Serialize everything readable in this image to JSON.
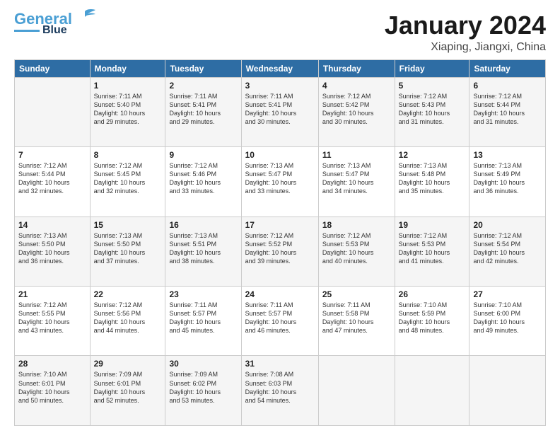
{
  "header": {
    "logo_line1": "General",
    "logo_line2": "Blue",
    "month": "January 2024",
    "location": "Xiaping, Jiangxi, China"
  },
  "weekdays": [
    "Sunday",
    "Monday",
    "Tuesday",
    "Wednesday",
    "Thursday",
    "Friday",
    "Saturday"
  ],
  "weeks": [
    [
      {
        "day": "",
        "content": ""
      },
      {
        "day": "1",
        "content": "Sunrise: 7:11 AM\nSunset: 5:40 PM\nDaylight: 10 hours\nand 29 minutes."
      },
      {
        "day": "2",
        "content": "Sunrise: 7:11 AM\nSunset: 5:41 PM\nDaylight: 10 hours\nand 29 minutes."
      },
      {
        "day": "3",
        "content": "Sunrise: 7:11 AM\nSunset: 5:41 PM\nDaylight: 10 hours\nand 30 minutes."
      },
      {
        "day": "4",
        "content": "Sunrise: 7:12 AM\nSunset: 5:42 PM\nDaylight: 10 hours\nand 30 minutes."
      },
      {
        "day": "5",
        "content": "Sunrise: 7:12 AM\nSunset: 5:43 PM\nDaylight: 10 hours\nand 31 minutes."
      },
      {
        "day": "6",
        "content": "Sunrise: 7:12 AM\nSunset: 5:44 PM\nDaylight: 10 hours\nand 31 minutes."
      }
    ],
    [
      {
        "day": "7",
        "content": "Sunrise: 7:12 AM\nSunset: 5:44 PM\nDaylight: 10 hours\nand 32 minutes."
      },
      {
        "day": "8",
        "content": "Sunrise: 7:12 AM\nSunset: 5:45 PM\nDaylight: 10 hours\nand 32 minutes."
      },
      {
        "day": "9",
        "content": "Sunrise: 7:12 AM\nSunset: 5:46 PM\nDaylight: 10 hours\nand 33 minutes."
      },
      {
        "day": "10",
        "content": "Sunrise: 7:13 AM\nSunset: 5:47 PM\nDaylight: 10 hours\nand 33 minutes."
      },
      {
        "day": "11",
        "content": "Sunrise: 7:13 AM\nSunset: 5:47 PM\nDaylight: 10 hours\nand 34 minutes."
      },
      {
        "day": "12",
        "content": "Sunrise: 7:13 AM\nSunset: 5:48 PM\nDaylight: 10 hours\nand 35 minutes."
      },
      {
        "day": "13",
        "content": "Sunrise: 7:13 AM\nSunset: 5:49 PM\nDaylight: 10 hours\nand 36 minutes."
      }
    ],
    [
      {
        "day": "14",
        "content": "Sunrise: 7:13 AM\nSunset: 5:50 PM\nDaylight: 10 hours\nand 36 minutes."
      },
      {
        "day": "15",
        "content": "Sunrise: 7:13 AM\nSunset: 5:50 PM\nDaylight: 10 hours\nand 37 minutes."
      },
      {
        "day": "16",
        "content": "Sunrise: 7:13 AM\nSunset: 5:51 PM\nDaylight: 10 hours\nand 38 minutes."
      },
      {
        "day": "17",
        "content": "Sunrise: 7:12 AM\nSunset: 5:52 PM\nDaylight: 10 hours\nand 39 minutes."
      },
      {
        "day": "18",
        "content": "Sunrise: 7:12 AM\nSunset: 5:53 PM\nDaylight: 10 hours\nand 40 minutes."
      },
      {
        "day": "19",
        "content": "Sunrise: 7:12 AM\nSunset: 5:53 PM\nDaylight: 10 hours\nand 41 minutes."
      },
      {
        "day": "20",
        "content": "Sunrise: 7:12 AM\nSunset: 5:54 PM\nDaylight: 10 hours\nand 42 minutes."
      }
    ],
    [
      {
        "day": "21",
        "content": "Sunrise: 7:12 AM\nSunset: 5:55 PM\nDaylight: 10 hours\nand 43 minutes."
      },
      {
        "day": "22",
        "content": "Sunrise: 7:12 AM\nSunset: 5:56 PM\nDaylight: 10 hours\nand 44 minutes."
      },
      {
        "day": "23",
        "content": "Sunrise: 7:11 AM\nSunset: 5:57 PM\nDaylight: 10 hours\nand 45 minutes."
      },
      {
        "day": "24",
        "content": "Sunrise: 7:11 AM\nSunset: 5:57 PM\nDaylight: 10 hours\nand 46 minutes."
      },
      {
        "day": "25",
        "content": "Sunrise: 7:11 AM\nSunset: 5:58 PM\nDaylight: 10 hours\nand 47 minutes."
      },
      {
        "day": "26",
        "content": "Sunrise: 7:10 AM\nSunset: 5:59 PM\nDaylight: 10 hours\nand 48 minutes."
      },
      {
        "day": "27",
        "content": "Sunrise: 7:10 AM\nSunset: 6:00 PM\nDaylight: 10 hours\nand 49 minutes."
      }
    ],
    [
      {
        "day": "28",
        "content": "Sunrise: 7:10 AM\nSunset: 6:01 PM\nDaylight: 10 hours\nand 50 minutes."
      },
      {
        "day": "29",
        "content": "Sunrise: 7:09 AM\nSunset: 6:01 PM\nDaylight: 10 hours\nand 52 minutes."
      },
      {
        "day": "30",
        "content": "Sunrise: 7:09 AM\nSunset: 6:02 PM\nDaylight: 10 hours\nand 53 minutes."
      },
      {
        "day": "31",
        "content": "Sunrise: 7:08 AM\nSunset: 6:03 PM\nDaylight: 10 hours\nand 54 minutes."
      },
      {
        "day": "",
        "content": ""
      },
      {
        "day": "",
        "content": ""
      },
      {
        "day": "",
        "content": ""
      }
    ]
  ]
}
